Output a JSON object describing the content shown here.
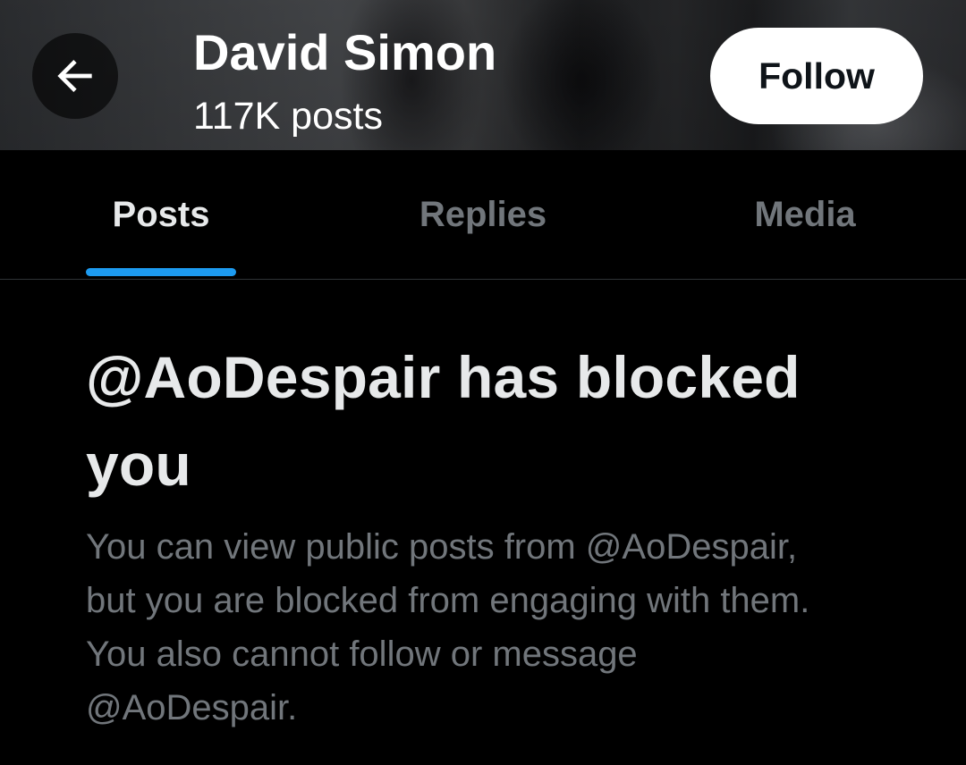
{
  "header": {
    "back_icon": "arrow-left-icon",
    "name": "David Simon",
    "post_count": "117K posts",
    "follow_label": "Follow"
  },
  "tabs": [
    {
      "label": "Posts",
      "active": true
    },
    {
      "label": "Replies",
      "active": false
    },
    {
      "label": "Media",
      "active": false
    }
  ],
  "blocked": {
    "title": "@AoDespair has blocked you",
    "description": "You can view public posts from @AoDespair, but you are blocked from engaging with them. You also cannot follow or message @AoDespair."
  },
  "colors": {
    "background": "#000000",
    "accent": "#1d9bf0",
    "primary_text": "#e7e9ea",
    "secondary_text": "#71767b",
    "follow_button_bg": "#ffffff"
  }
}
